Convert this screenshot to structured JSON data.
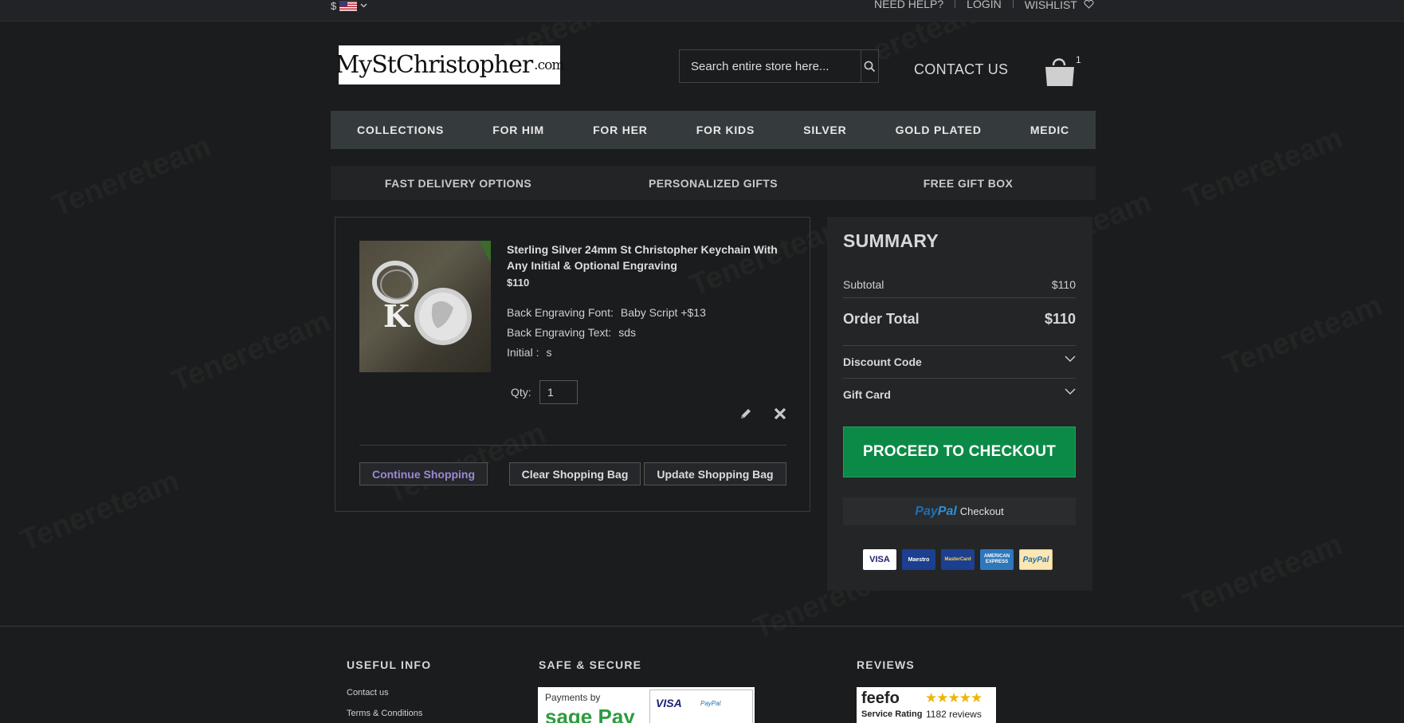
{
  "topbar": {
    "currency": "$",
    "links": [
      "NEED HELP?",
      "LOGIN",
      "WISHLIST"
    ]
  },
  "header": {
    "logo_text": "MyStChristopher",
    "logo_suffix": ".com",
    "search_placeholder": "Search entire store here...",
    "contact": "CONTACT US",
    "cart_count": "1"
  },
  "nav": [
    "COLLECTIONS",
    "FOR HIM",
    "FOR HER",
    "FOR KIDS",
    "SILVER",
    "GOLD PLATED",
    "MEDIC"
  ],
  "subnav": [
    "FAST DELIVERY OPTIONS",
    "PERSONALIZED GIFTS",
    "FREE GIFT BOX"
  ],
  "cart_item": {
    "image_letter": "K",
    "name": "Sterling Silver 24mm St Christopher Keychain With Any Initial & Optional Engraving",
    "price": "$110",
    "options": [
      {
        "label": "Back Engraving Font:",
        "value": "Baby Script +$13"
      },
      {
        "label": "Back Engraving Text:",
        "value": "sds"
      },
      {
        "label": "Initial :",
        "value": "s"
      }
    ],
    "qty_label": "Qty:",
    "qty": "1"
  },
  "cart_actions": {
    "continue": "Continue Shopping",
    "clear": "Clear Shopping Bag",
    "update": "Update Shopping Bag"
  },
  "summary": {
    "title": "SUMMARY",
    "subtotal_label": "Subtotal",
    "subtotal_value": "$110",
    "total_label": "Order Total",
    "total_value": "$110",
    "discount_label": "Discount Code",
    "giftcard_label": "Gift Card",
    "checkout": "PROCEED TO CHECKOUT",
    "paypal_brand_a": "Pay",
    "paypal_brand_b": "Pal",
    "paypal_checkout": "Checkout",
    "cards": [
      "VISA",
      "Maestro",
      "MasterCard",
      "AMERICAN EXPRESS",
      "PayPal"
    ]
  },
  "footer": {
    "useful_info": "USEFUL INFO",
    "links": [
      "Contact us",
      "Terms & Conditions"
    ],
    "safe_secure": "SAFE & SECURE",
    "sagepay_caption": "Payments by",
    "sagepay_brand": "sage Pay",
    "sagepay_cards": [
      "VISA",
      "PayPal"
    ],
    "reviews": "REVIEWS",
    "feefo_brand": "feefo",
    "feefo_rating_label": "Service Rating",
    "feefo_reviews": "1182 reviews"
  },
  "watermark": "Tenereteam"
}
